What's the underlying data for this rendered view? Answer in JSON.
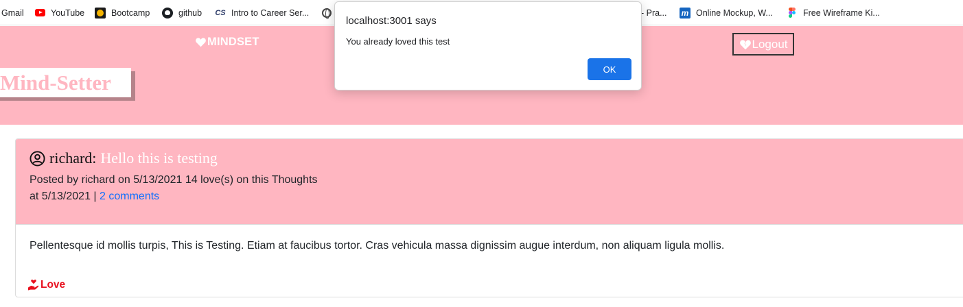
{
  "bookmarks": [
    {
      "label": "Gmail",
      "icon": "gmail-icon"
    },
    {
      "label": "YouTube",
      "icon": "youtube-icon"
    },
    {
      "label": "Bootcamp",
      "icon": "bootcamp-icon"
    },
    {
      "label": "github",
      "icon": "github-icon"
    },
    {
      "label": "Intro to Career Ser...",
      "icon": "cs-icon"
    },
    {
      "label": "",
      "icon": "globe-icon"
    },
    {
      "label": "- Pra...",
      "icon": ""
    },
    {
      "label": "Online Mockup, W...",
      "icon": "moqups-icon"
    },
    {
      "label": "Free Wireframe Ki...",
      "icon": "figma-icon"
    }
  ],
  "header": {
    "brand": "MINDSET",
    "logout_label": "Logout",
    "site_title": "Mind-Setter",
    "background": "#ffb6c1"
  },
  "post": {
    "username": "richard:",
    "thought_title": "Hello this is testing",
    "meta_line1": "Posted by richard on 5/13/2021 14 love(s) on this Thoughts",
    "meta_line2_prefix": "at 5/13/2021 | ",
    "comments_link": "2 comments",
    "body": "Pellentesque id mollis turpis, This is Testing. Etiam at faucibus tortor. Cras vehicula massa dignissim augue interdum, non aliquam ligula mollis.",
    "love_label": "Love",
    "love_color": "#e8101e"
  },
  "dialog": {
    "origin": "localhost:3001 says",
    "message": "You already loved this test",
    "ok_label": "OK",
    "ok_color": "#1a73e8"
  }
}
